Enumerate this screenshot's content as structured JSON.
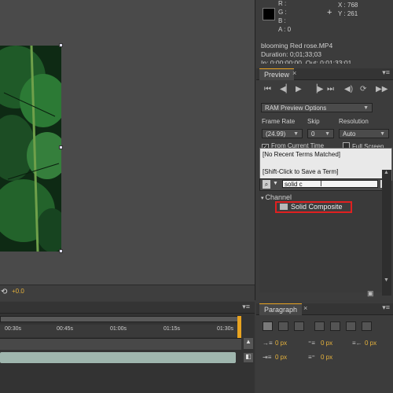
{
  "info": {
    "channels": [
      "R :",
      "G :",
      "B :",
      "A : 0"
    ],
    "x": "X : 768",
    "y": "Y : 261",
    "file_name": "blooming Red rose.MP4",
    "duration": "Duration: 0;01;33;03",
    "in_out": "In: 0;00;00;00, Out: 0;01;33;01"
  },
  "viewer": {
    "exposure": "+0.0"
  },
  "preview": {
    "tab": "Preview",
    "ram_options": "RAM Preview Options",
    "frame_rate_label": "Frame Rate",
    "frame_rate_value": "(24.99)",
    "skip_label": "Skip",
    "skip_value": "0",
    "resolution_label": "Resolution",
    "resolution_value": "Auto",
    "from_current": "From Current Time",
    "full_screen": "Full Screen"
  },
  "effects": {
    "dropdown_items": [
      "[No Recent Terms Matched]",
      "[Shift-Click to Save a Term]"
    ],
    "search_value": "solid c",
    "category": "Channel",
    "result": "Solid Composite"
  },
  "timeline": {
    "ticks": [
      "00:30s",
      "00:45s",
      "01:00s",
      "01:15s",
      "01:30s"
    ]
  },
  "paragraph": {
    "tab": "Paragraph",
    "indent_values": [
      "0 px",
      "0 px",
      "0 px",
      "0 px",
      "0 px"
    ]
  }
}
